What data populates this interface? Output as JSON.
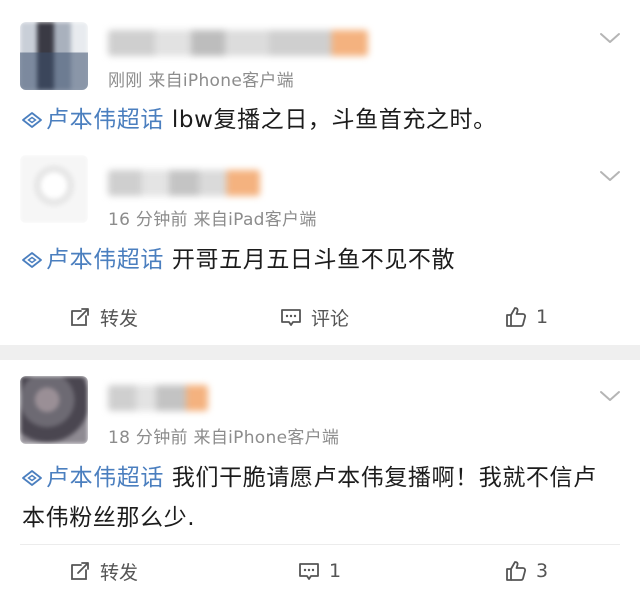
{
  "topic_label": "卢本伟超话",
  "posts": [
    {
      "source": "刚刚 来自iPhone客户端",
      "text": "lbw复播之日，斗鱼首充之时。"
    },
    {
      "source": "16 分钟前  来自iPad客户端",
      "text": "开哥五月五日斗鱼不见不散",
      "actions": {
        "repost": "转发",
        "comment": "评论",
        "like_count": "1"
      }
    },
    {
      "source": "18 分钟前  来自iPhone客户端",
      "text": "我们干脆请愿卢本伟复播啊！我就不信卢本伟粉丝那么少.",
      "actions": {
        "repost": "转发",
        "comment_count": "1",
        "like_count": "3"
      }
    }
  ],
  "colors": {
    "topic": "#4b7fbf",
    "meta": "#8c8c8c",
    "separator": "#efefef"
  },
  "icons": [
    "chevron-down-icon",
    "topic-diamond-icon",
    "repost-icon",
    "comment-icon",
    "like-icon"
  ]
}
